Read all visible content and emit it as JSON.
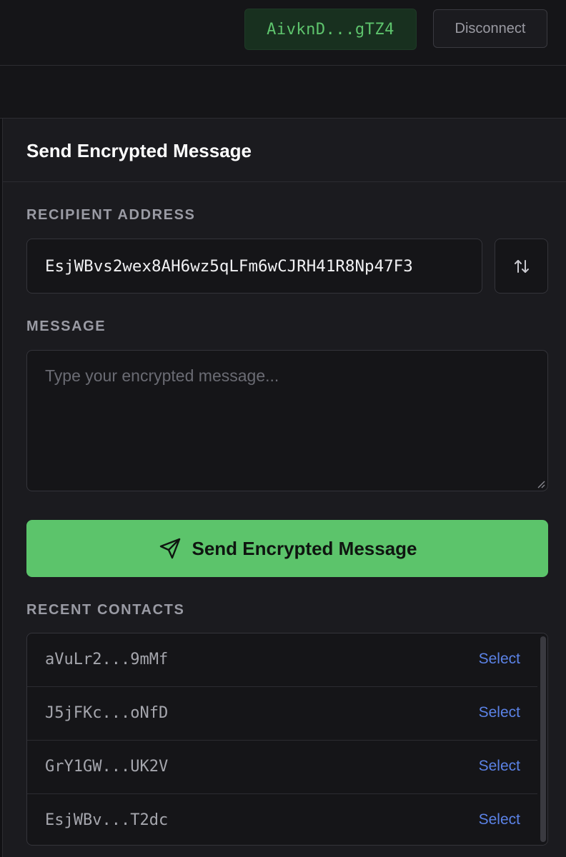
{
  "header": {
    "wallet_address": "AivknD...gTZ4",
    "disconnect_label": "Disconnect"
  },
  "card": {
    "title": "Send Encrypted Message",
    "recipient_label": "RECIPIENT ADDRESS",
    "recipient_value": "EsjWBvs2wex8AH6wz5qLFm6wCJRH41R8Np47F3",
    "swap_icon": "swap-vertical-icon",
    "message_label": "MESSAGE",
    "message_placeholder": "Type your encrypted message...",
    "send_label": "Send Encrypted Message",
    "send_icon": "send-icon",
    "contacts_label": "RECENT CONTACTS"
  },
  "contacts": [
    {
      "address": "aVuLr2...9mMf",
      "action": "Select"
    },
    {
      "address": "J5jFKc...oNfD",
      "action": "Select"
    },
    {
      "address": "GrY1GW...UK2V",
      "action": "Select"
    },
    {
      "address": "EsjWBv...T2dc",
      "action": "Select"
    }
  ],
  "colors": {
    "background": "#151518",
    "card": "#1b1b1f",
    "accent_green": "#5cc46b",
    "link_blue": "#5b82e6",
    "wallet_chip_bg": "#18301f"
  }
}
